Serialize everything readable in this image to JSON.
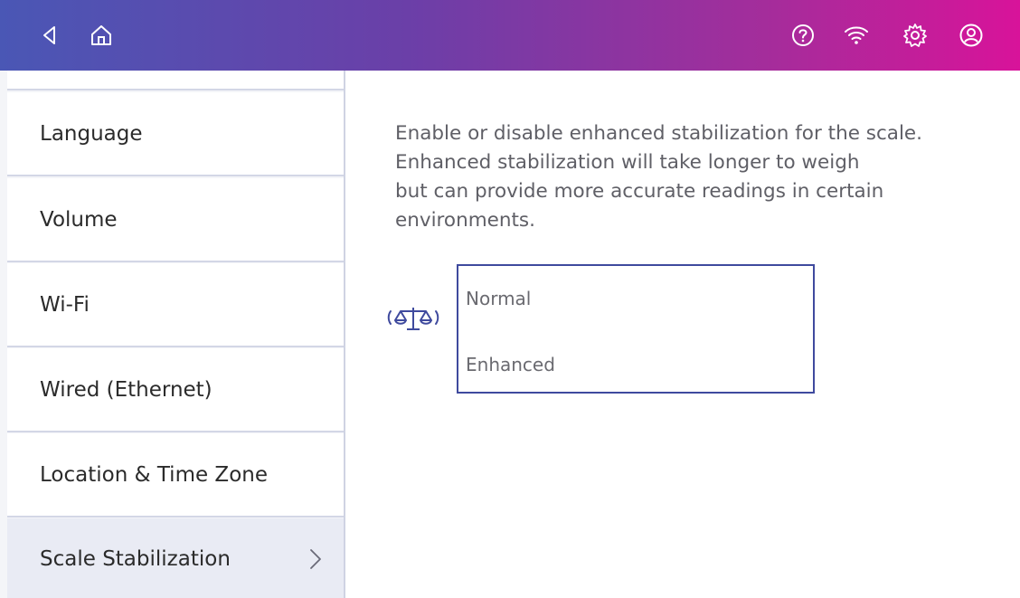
{
  "topbar": {
    "back_icon": "back-arrow-icon",
    "home_icon": "home-icon",
    "help_icon": "help-icon",
    "wifi_icon": "wifi-icon",
    "settings_icon": "gear-icon",
    "account_icon": "account-icon",
    "gradient_colors": [
      "#4a57b5",
      "#d8139a"
    ]
  },
  "sidebar": {
    "items": [
      {
        "label": "Language"
      },
      {
        "label": "Volume"
      },
      {
        "label": "Wi-Fi"
      },
      {
        "label": "Wired (Ethernet)"
      },
      {
        "label": "Location & Time Zone"
      },
      {
        "label": "Scale Stabilization",
        "active": true
      }
    ]
  },
  "main": {
    "description_lines": [
      "Enable or disable enhanced stabilization for the scale.",
      "Enhanced stabilization will take longer to weigh",
      "but can provide more accurate readings in certain",
      "environments."
    ],
    "scale_icon": "scale-icon",
    "options": [
      {
        "label": "Normal"
      },
      {
        "label": "Enhanced"
      }
    ]
  },
  "colors": {
    "accent": "#3f4a9e",
    "sidebar_active_bg": "#e9ebf4"
  }
}
